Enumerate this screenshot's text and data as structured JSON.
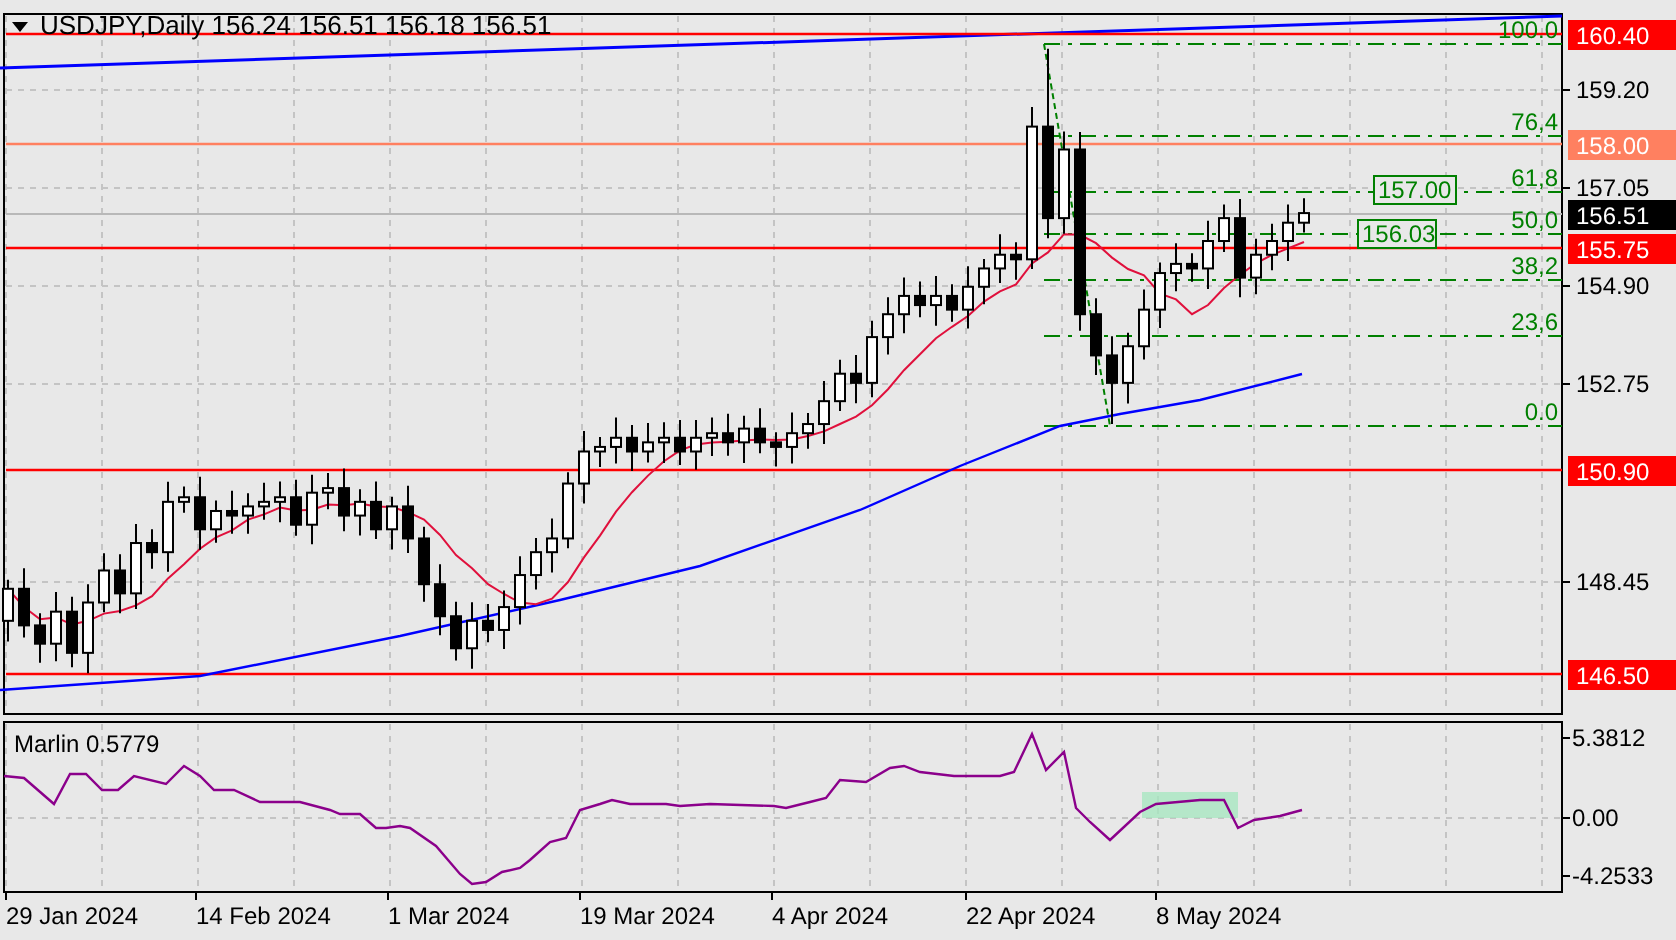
{
  "header": {
    "symbol": "USDJPY,Daily",
    "open": "156.24",
    "high": "156.51",
    "low": "156.18",
    "close": "156.51"
  },
  "price_axis": {
    "ticks": [
      "159.20",
      "157.05",
      "154.90",
      "152.75",
      "148.45"
    ]
  },
  "price_lines": [
    {
      "label": "160.40",
      "color": "#ff0000"
    },
    {
      "label": "158.00",
      "color": "#ff8060"
    },
    {
      "label": "155.75",
      "color": "#ff0000"
    },
    {
      "label": "150.90",
      "color": "#ff0000"
    },
    {
      "label": "146.50",
      "color": "#ff0000"
    }
  ],
  "current_price": {
    "label": "156.51"
  },
  "fibonacci": {
    "levels": [
      "100.0",
      "76,4",
      "61,8",
      "50,0",
      "38,2",
      "23,6",
      "0.0"
    ]
  },
  "price_boxes": [
    "157.00",
    "156.03"
  ],
  "indicator": {
    "title": "Marlin 0.5779",
    "ticks": [
      "5.3812",
      "0.00",
      "-4.2533"
    ]
  },
  "date_axis": [
    "29 Jan 2024",
    "14 Feb 2024",
    "1 Mar 2024",
    "19 Mar 2024",
    "4 Apr 2024",
    "22 Apr 2024",
    "8 May 2024"
  ]
}
